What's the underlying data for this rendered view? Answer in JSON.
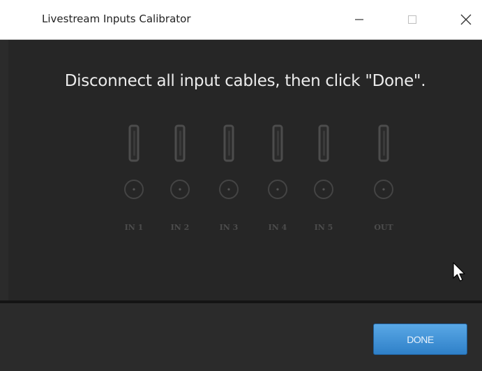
{
  "window": {
    "title": "Livestream Inputs Calibrator",
    "controls": [
      "minimize",
      "maximize",
      "close"
    ]
  },
  "main": {
    "instruction": "Disconnect all input cables, then click \"Done\".",
    "ports": [
      {
        "label": "IN 1"
      },
      {
        "label": "IN 2"
      },
      {
        "label": "IN 3"
      },
      {
        "label": "IN 4"
      },
      {
        "label": "IN 5"
      },
      {
        "label": "OUT"
      }
    ]
  },
  "footer": {
    "done_label": "DONE"
  },
  "colors": {
    "accent": "#3a8fd6",
    "background": "#262626",
    "port": "#4c4c4c"
  }
}
